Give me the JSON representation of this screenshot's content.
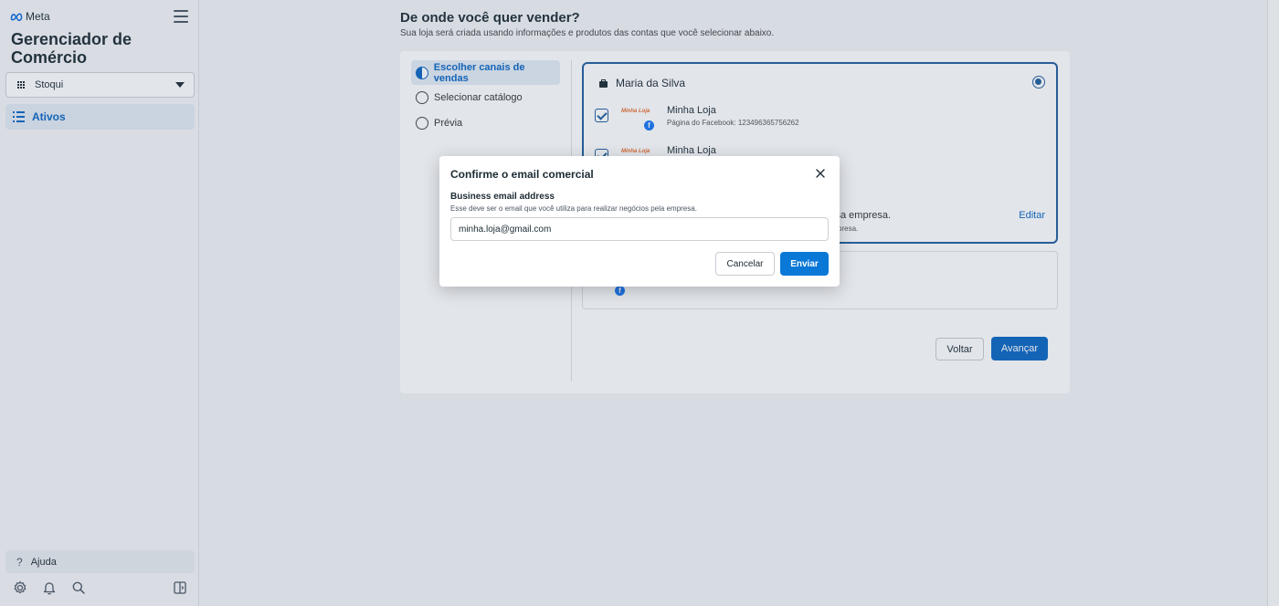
{
  "sidebar": {
    "brand": "Meta",
    "app_title": "Gerenciador de Comércio",
    "account": "Stoqui",
    "nav_active": "Ativos",
    "help": "Ajuda",
    "bottom_icons": [
      "settings-icon",
      "bell-icon",
      "search-icon",
      "panel-toggle-icon"
    ]
  },
  "main": {
    "title": "De onde você quer vender?",
    "subtitle": "Sua loja será criada usando informações e produtos das contas que você selecionar abaixo.",
    "steps": [
      "Escolher canais de vendas",
      "Selecionar catálogo",
      "Prévia"
    ],
    "card": {
      "owner": "Maria da Silva",
      "shops": [
        {
          "logo_text": "Minha Loja",
          "name": "Minha Loja",
          "sub": "Página do Facebook: 123496365756262"
        },
        {
          "logo_text": "Minha Loja",
          "name": "Minha Loja",
          "sub": ""
        }
      ],
      "partial_text": "ssa empresa.",
      "partial_sub": "presa.",
      "edit": "Editar"
    },
    "back_button": "Voltar",
    "next_button": "Avançar"
  },
  "modal": {
    "title": "Confirme o email comercial",
    "field_label": "Business email address",
    "field_help": "Esse deve ser o email que você utiliza para realizar negócios pela empresa.",
    "email_value": "minha.loja@gmail.com",
    "cancel": "Cancelar",
    "send": "Enviar"
  },
  "colors": {
    "primary": "#0a78d7",
    "accent": "#1f5d9c",
    "overlay": "rgba(74,96,126,0.16)"
  }
}
